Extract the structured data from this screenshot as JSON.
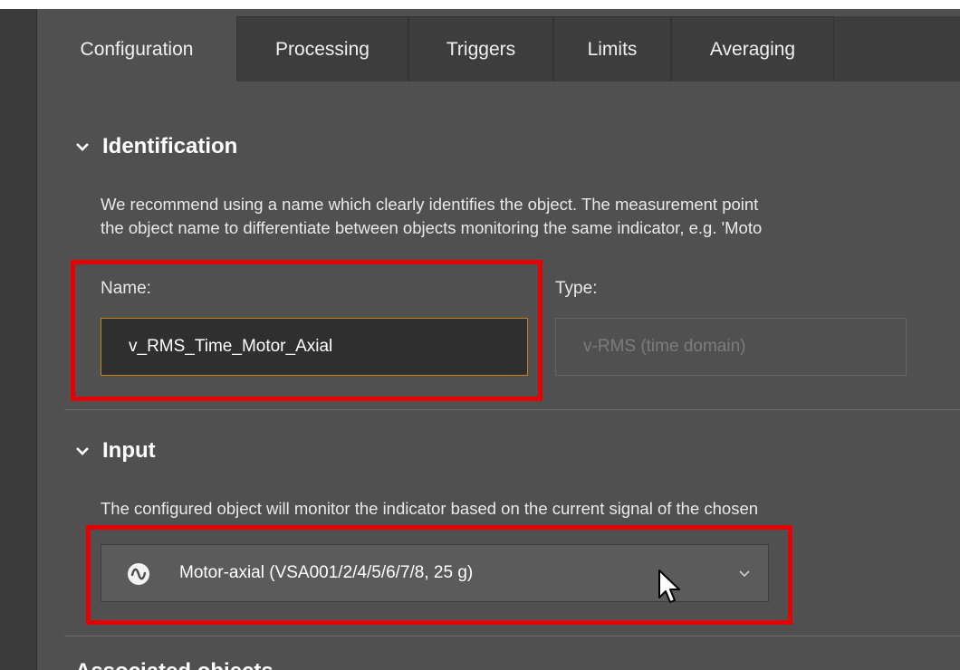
{
  "tabs": [
    {
      "label": "Configuration",
      "active": true
    },
    {
      "label": "Processing",
      "active": false
    },
    {
      "label": "Triggers",
      "active": false
    },
    {
      "label": "Limits",
      "active": false
    },
    {
      "label": "Averaging",
      "active": false
    }
  ],
  "identification": {
    "header": "Identification",
    "description_line1": "We recommend using a name which clearly identifies the object. The measurement point",
    "description_line2": "the object name to differentiate between objects monitoring the same indicator, e.g. 'Moto",
    "name_label": "Name:",
    "name_value": "v_RMS_Time_Motor_Axial",
    "type_label": "Type:",
    "type_value": "v-RMS (time domain)"
  },
  "input": {
    "header": "Input",
    "description": "The configured object will monitor the indicator based on the current signal of the chosen",
    "selected_value": "Motor-axial (VSA001/2/4/5/6/7/8, 25 g)",
    "icon": "signal-wave-icon"
  },
  "next_section": {
    "header": "Associated objects"
  },
  "colors": {
    "panel": "#505050",
    "tab_inactive": "#3d3d3d",
    "focus_border": "#c8821c",
    "highlight": "#e60000"
  }
}
